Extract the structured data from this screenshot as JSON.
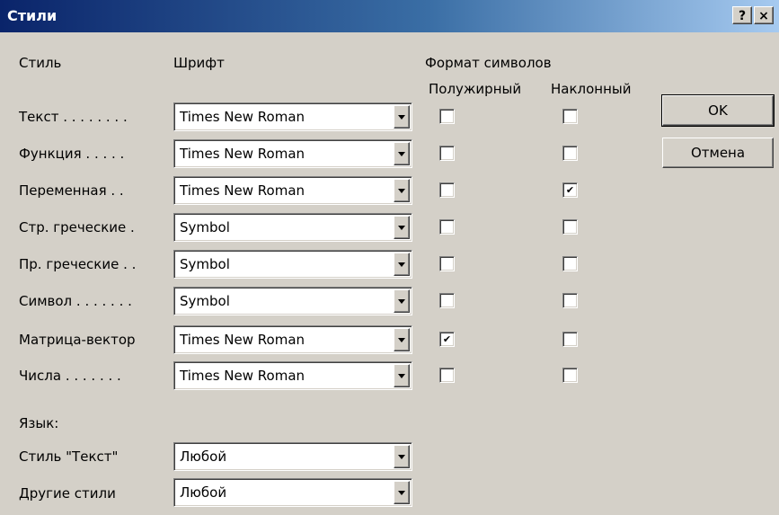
{
  "window": {
    "title": "Стили",
    "help_button": "?",
    "close_button": "×"
  },
  "headers": {
    "style": "Стиль",
    "font": "Шрифт",
    "format": "Формат символов",
    "bold": "Полужирный",
    "italic": "Наклонный"
  },
  "rows": [
    {
      "label": "Текст . . . . . . . .",
      "font": "Times New Roman",
      "bold": false,
      "italic": false
    },
    {
      "label": "Функция . . . . .",
      "font": "Times New Roman",
      "bold": false,
      "italic": false
    },
    {
      "label": "Переменная . .",
      "font": "Times New Roman",
      "bold": false,
      "italic": true
    },
    {
      "label": "Стр. греческие .",
      "font": "Symbol",
      "bold": false,
      "italic": false
    },
    {
      "label": "Пр. греческие . .",
      "font": "Symbol",
      "bold": false,
      "italic": false
    },
    {
      "label": "Символ . . . . . . .",
      "font": "Symbol",
      "bold": false,
      "italic": false
    },
    {
      "label": "Матрица-вектор",
      "font": "Times New Roman",
      "bold": true,
      "italic": false
    },
    {
      "label": "Числа . . . . . . .",
      "font": "Times New Roman",
      "bold": false,
      "italic": false
    }
  ],
  "language": {
    "heading": "Язык:",
    "text_style_label": "Стиль \"Текст\"",
    "text_style_value": "Любой",
    "other_styles_label": "Другие стили",
    "other_styles_value": "Любой"
  },
  "buttons": {
    "ok": "OK",
    "cancel": "Отмена"
  }
}
